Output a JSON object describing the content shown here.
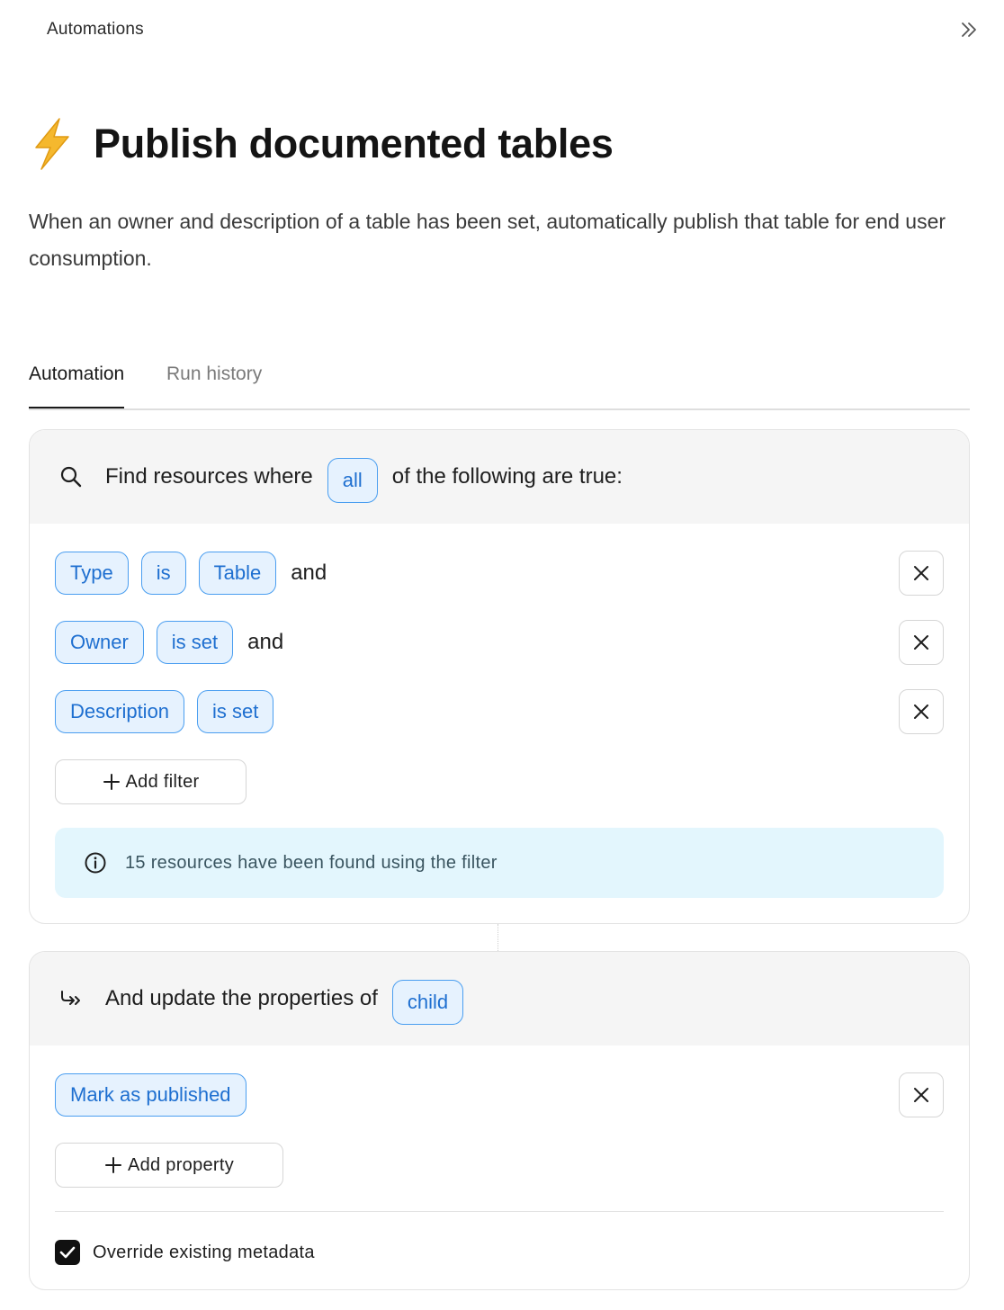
{
  "breadcrumb": "Automations",
  "title": "Publish documented tables",
  "description": "When an owner and description of a table has been set, automatically publish that table for end user consumption.",
  "tabs": [
    {
      "label": "Automation",
      "active": true
    },
    {
      "label": "Run history",
      "active": false
    }
  ],
  "find_section": {
    "prefix": "Find resources where",
    "quantifier": "all",
    "suffix": "of the following are true:",
    "filters": [
      {
        "field": "Type",
        "operator": "is",
        "value": "Table",
        "joiner": "and"
      },
      {
        "field": "Owner",
        "operator": "is set",
        "joiner": "and"
      },
      {
        "field": "Description",
        "operator": "is set"
      }
    ],
    "add_filter_label": "Add filter",
    "info_text": "15 resources have been found using the filter"
  },
  "update_section": {
    "prefix": "And update the properties of",
    "target": "child",
    "properties": [
      {
        "label": "Mark as published"
      }
    ],
    "add_property_label": "Add property",
    "override_label": "Override existing metadata",
    "override_checked": true
  },
  "colors": {
    "chip_bg": "#e6f2fe",
    "chip_border": "#4a9ef0",
    "chip_text": "#1e6fd0",
    "info_bg": "#e3f6fd",
    "lightning": "#f5b82e"
  }
}
